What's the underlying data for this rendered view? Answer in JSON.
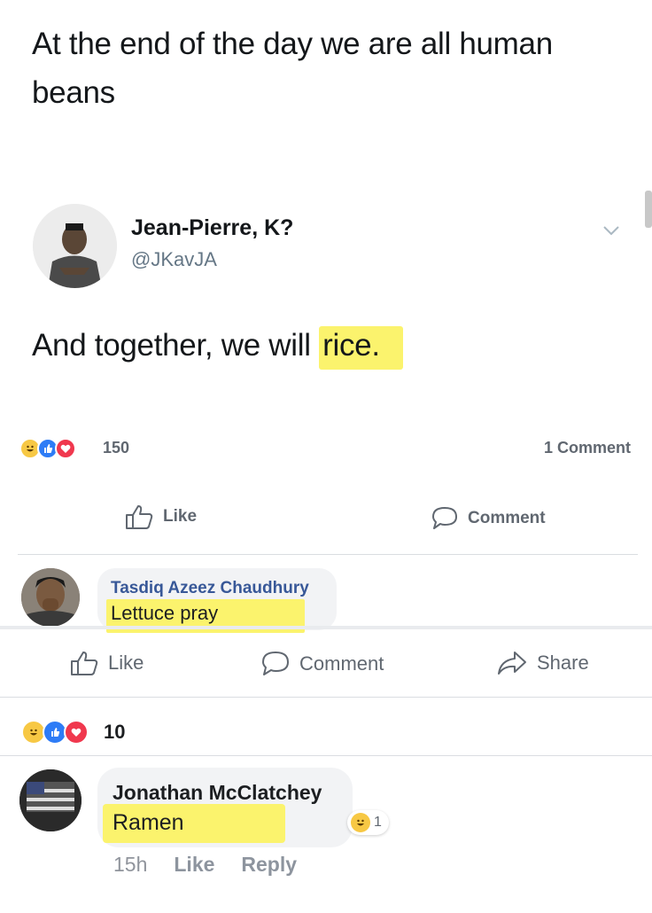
{
  "tweet": {
    "top_text": "At the end of the day we are all human beans",
    "author_name": "Jean-Pierre, K?",
    "author_handle": "@JKavJA",
    "body_prefix": "And together, we will ",
    "body_highlight": "rice."
  },
  "inner_post": {
    "reaction_count": "150",
    "comments_count": "1 Comment",
    "like_label": "Like",
    "comment_label": "Comment",
    "comment": {
      "author": "Tasdiq Azeez Chaudhury",
      "text": "Lettuce pray"
    }
  },
  "outer_post": {
    "like_label": "Like",
    "comment_label": "Comment",
    "share_label": "Share",
    "reaction_count": "10",
    "comment": {
      "author": "Jonathan McClatchey",
      "text": "Ramen",
      "reaction_count": "1",
      "time": "15h",
      "like_label": "Like",
      "reply_label": "Reply"
    }
  },
  "colors": {
    "highlight": "#fbf36d",
    "like_blue": "#2e7cf6",
    "love_red": "#f0384e",
    "haha_yellow": "#f7c844",
    "fb_link": "#385898"
  },
  "icons": [
    "haha-icon",
    "like-reaction-icon",
    "love-icon",
    "thumbs-up-icon",
    "comment-icon",
    "share-icon",
    "chevron-down-icon"
  ]
}
